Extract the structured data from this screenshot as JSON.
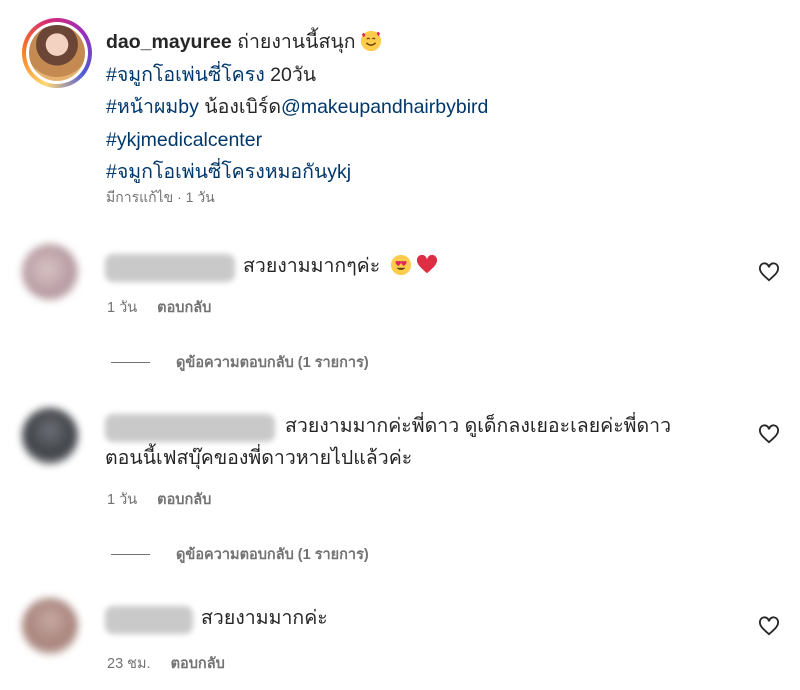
{
  "post": {
    "username": "dao_mayuree",
    "caption_line1": " ถ่ายงานนี้สนุก",
    "hashtag1": "#จมูกโอเพ่นซี่โครง",
    "hashtag1_tail": " 20วัน",
    "hashtag2": "#หน้าผมby",
    "hashtag2_mid": " น้องเบิร์ด",
    "mention": "@makeupandhairbybird",
    "hashtag3": "#ykjmedicalcenter",
    "hashtag4": "#จมูกโอเพ่นซี่โครงหมอกันykj",
    "meta": "มีการแก้ไข · 1 วัน"
  },
  "comments": [
    {
      "text": "สวยงามมากๆค่ะ",
      "time": "1 วัน",
      "reply_label": "ตอบกลับ",
      "view_replies": "ดูข้อความตอบกลับ (1 รายการ)"
    },
    {
      "text_line1": "สวยงามมากค่ะพี่ดาว ดูเด็กลงเยอะเลยค่ะพี่ดาว",
      "text_line2": "ตอนนี้เฟสบุ๊คของพี่ดาวหายไปแล้วค่ะ",
      "time": "1 วัน",
      "reply_label": "ตอบกลับ",
      "view_replies": "ดูข้อความตอบกลับ (1 รายการ)"
    },
    {
      "text": "สวยงามมากค่ะ",
      "time": "23 ชม.",
      "reply_label": "ตอบกลับ"
    }
  ],
  "icons": {
    "like": "heart-outline-icon",
    "emoji_caption": "smiling-face-with-hearts-emoji",
    "emoji_heart_eyes": "heart-eyes-emoji",
    "emoji_red_heart": "red-heart-emoji"
  },
  "colors": {
    "link": "#00376b",
    "text": "#262626",
    "secondary": "#737373"
  }
}
